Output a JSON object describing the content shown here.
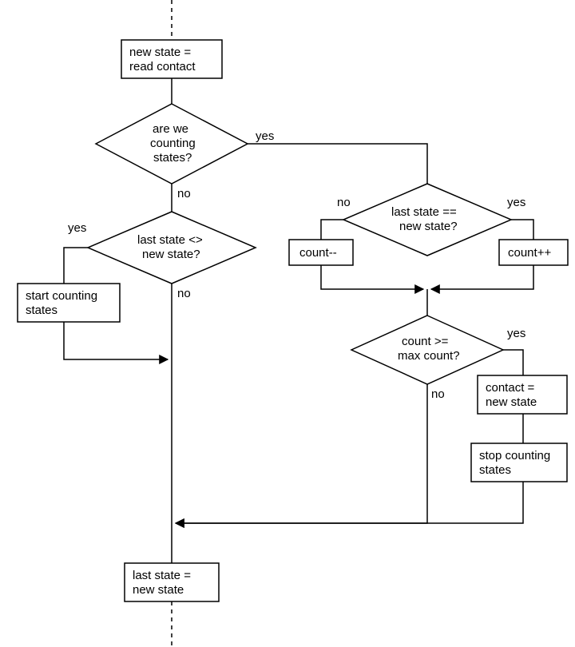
{
  "nodes": {
    "n_read": {
      "l1": "new state =",
      "l2": "read contact"
    },
    "d_counting": {
      "l1": "are we",
      "l2": "counting",
      "l3": "states?"
    },
    "d_neq": {
      "l1": "last state <>",
      "l2": "new state?"
    },
    "n_start": {
      "l1": "start counting",
      "l2": "states"
    },
    "d_eq": {
      "l1": "last state ==",
      "l2": "new state?"
    },
    "n_dec": {
      "l1": "count--"
    },
    "n_inc": {
      "l1": "count++"
    },
    "d_max": {
      "l1": "count >=",
      "l2": "max count?"
    },
    "n_contact": {
      "l1": "contact =",
      "l2": "new state"
    },
    "n_stop": {
      "l1": "stop counting",
      "l2": "states"
    },
    "n_last": {
      "l1": "last state =",
      "l2": "new state"
    }
  },
  "labels": {
    "yes": "yes",
    "no": "no"
  }
}
